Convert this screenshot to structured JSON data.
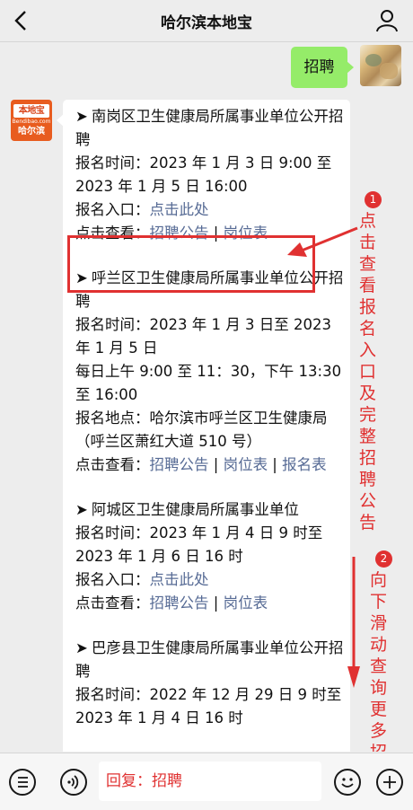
{
  "header": {
    "title": "哈尔滨本地宝"
  },
  "sent": {
    "text": "招聘"
  },
  "bot_avatar": {
    "logo_text": "本地宝",
    "logo_url": "Bendibao.com",
    "logo_city": "哈尔滨"
  },
  "jobs": [
    {
      "title": "南岗区卫生健康局所属事业单位公开招聘",
      "time_label": "报名时间：",
      "time_value": "2023 年 1 月 3 日 9:00 至 2023 年 1 月 5 日 16:00",
      "entry_label": "报名入口：",
      "entry_link": "点击此处",
      "view_label": "点击查看：",
      "link1": "招聘公告",
      "sep": " | ",
      "link2": "岗位表"
    },
    {
      "title": "呼兰区卫生健康局所属事业单位公开招聘",
      "time_label": "报名时间：",
      "time_value": "2023 年 1 月 3 日至 2023 年 1 月 5 日",
      "hours": "每日上午 9:00 至 11：30，下午 13:30 至 16:00",
      "place_label": "报名地点：",
      "place_value": "哈尔滨市呼兰区卫生健康局（呼兰区萧红大道 510 号）",
      "view_label": "点击查看：",
      "link1": "招聘公告",
      "sep": " | ",
      "link2": "岗位表",
      "link3": "报名表"
    },
    {
      "title": "阿城区卫生健康局所属事业单位",
      "time_label": "报名时间：",
      "time_value": "2023 年 1 月 4 日 9 时至 2023 年 1 月 6 日 16 时",
      "entry_label": "报名入口：",
      "entry_link": "点击此处",
      "view_label": "点击查看：",
      "link1": "招聘公告",
      "sep": " | ",
      "link2": "岗位表"
    },
    {
      "title": "巴彦县卫生健康局所属事业单位公开招聘",
      "time_label": "报名时间：",
      "time_value": "2022 年 12 月 29 日 9 时至 2023 年 1 月 4 日 16 时"
    }
  ],
  "annotations": {
    "a1_num": "1",
    "a1_text": "点击查看报名入口及完整招聘公告",
    "a2_num": "2",
    "a2_text": "向下滑动查询更多招聘信息"
  },
  "input": {
    "value": "回复：招聘"
  },
  "colors": {
    "link": "#576b95",
    "annotation": "#e03131",
    "sent_bubble": "#95ec69"
  },
  "icons": [
    "back-icon",
    "profile-icon",
    "list-menu-icon",
    "voice-icon",
    "emoji-icon",
    "plus-icon"
  ]
}
